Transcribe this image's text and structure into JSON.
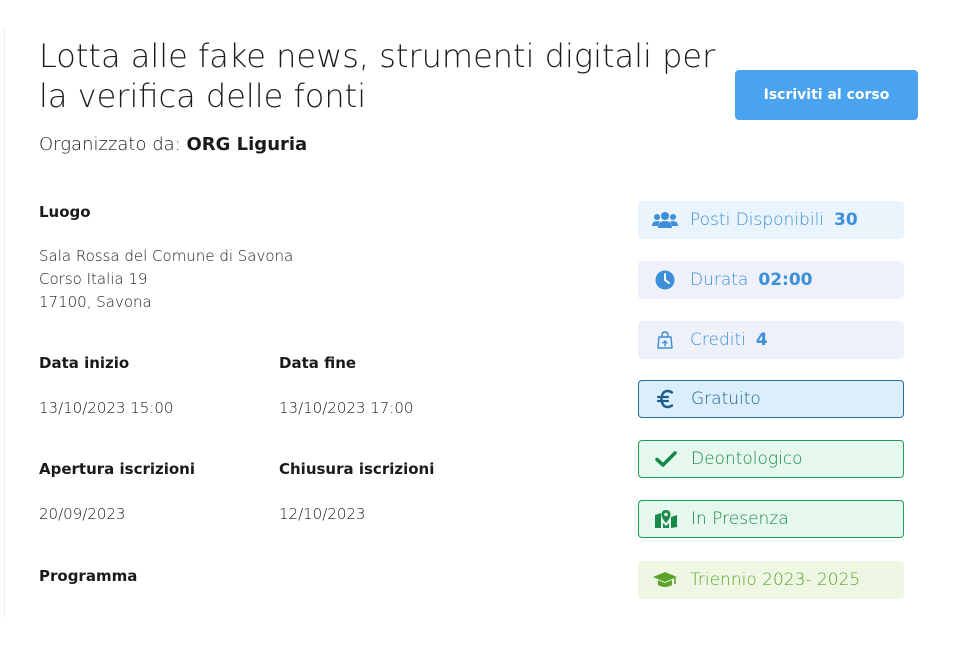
{
  "course": {
    "title": "Lotta alle fake news, strumenti digitali per la verifica delle fonti",
    "organizer_prefix": "Organizzato da:",
    "organizer_name": "ORG Liguria",
    "enroll_button": "Iscriviti al corso"
  },
  "location": {
    "label": "Luogo",
    "lines": [
      "Sala Rossa del Comune di Savona",
      "Corso Italia 19",
      "17100, Savona"
    ]
  },
  "dates": {
    "start_label": "Data inizio",
    "start_value": "13/10/2023 15:00",
    "end_label": "Data fine",
    "end_value": "13/10/2023 17:00",
    "enroll_open_label": "Apertura iscrizioni",
    "enroll_open_value": "20/09/2023",
    "enroll_close_label": "Chiusura iscrizioni",
    "enroll_close_value": "12/10/2023"
  },
  "program": {
    "label": "Programma"
  },
  "badges": {
    "seats": {
      "icon": "users-icon",
      "label": "Posti Disponibili",
      "value": "30"
    },
    "duration": {
      "icon": "clock-icon",
      "label": "Durata",
      "value": "02:00"
    },
    "credits": {
      "icon": "shopping-bag-icon",
      "label": "Crediti",
      "value": "4"
    },
    "free": {
      "icon": "euro-icon",
      "label": "Gratuito"
    },
    "deontological": {
      "icon": "check-icon",
      "label": "Deontologico"
    },
    "in_person": {
      "icon": "map-marker-icon",
      "label": "In Presenza"
    },
    "triennium": {
      "icon": "graduation-cap-icon",
      "label": "Triennio 2023- 2025"
    }
  },
  "colors": {
    "primary_button": "#4aa3ef",
    "info_blue": "#3c8fd8",
    "success_green": "#178a49",
    "lime_green": "#5ca22b"
  }
}
